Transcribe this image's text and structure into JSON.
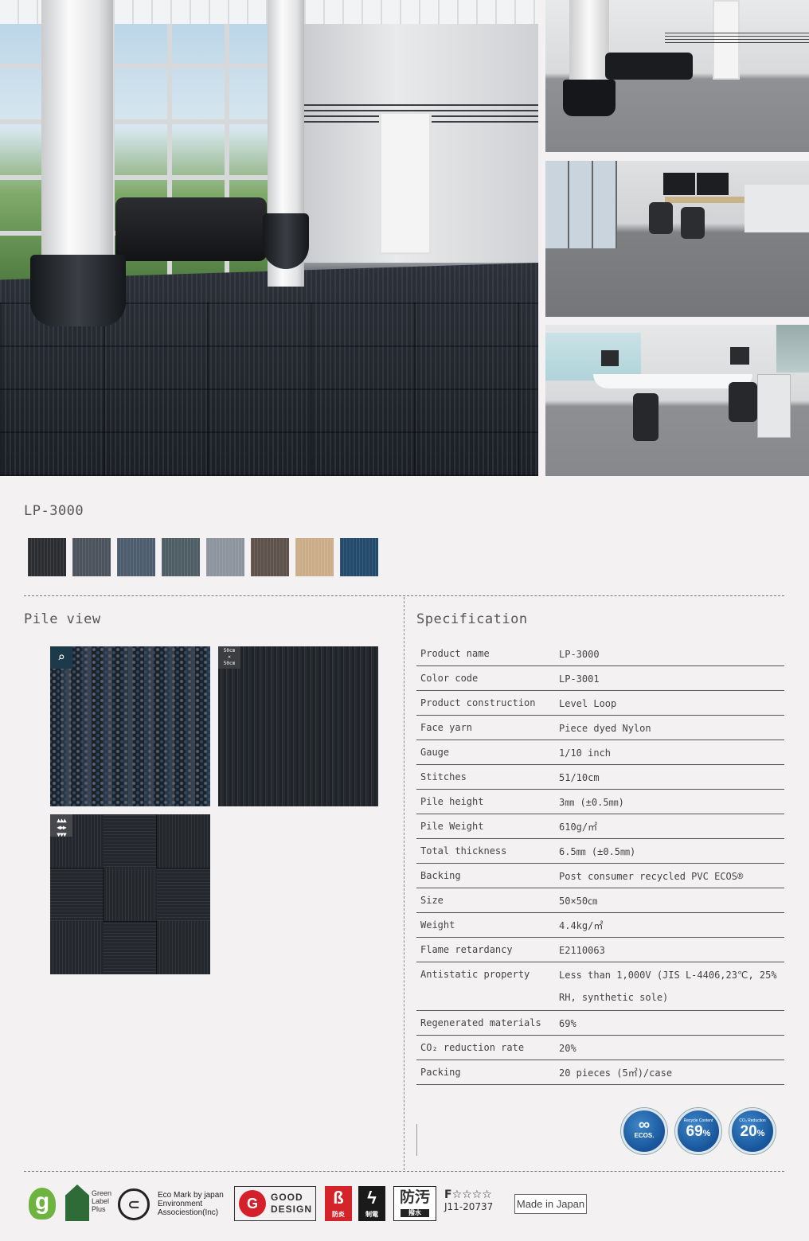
{
  "product": {
    "name": "LP-3000",
    "swatch_colors": [
      "#2b2d30",
      "#4b535c",
      "#4e5d6d",
      "#4f5e65",
      "#8c949d",
      "#5e534b",
      "#cbae88",
      "#224a6b"
    ]
  },
  "pile_view": {
    "title": "Pile view",
    "zoom_icon": "magnifier-icon",
    "size_badge": [
      "50cm",
      "×",
      "50cm"
    ],
    "layout_icon": "arrows-icon"
  },
  "specification": {
    "title": "Specification",
    "rows": [
      {
        "label": "Product name",
        "value": "LP-3000"
      },
      {
        "label": "Color code",
        "value": "LP-3001"
      },
      {
        "label": "Product construction",
        "value": "Level Loop"
      },
      {
        "label": "Face yarn",
        "value": "Piece dyed Nylon"
      },
      {
        "label": "Gauge",
        "value": "1/10 inch"
      },
      {
        "label": "Stitches",
        "value": "51/10cm"
      },
      {
        "label": "Pile height",
        "value": "3㎜ (±0.5㎜)"
      },
      {
        "label": "Pile Weight",
        "value": "610g/㎡"
      },
      {
        "label": "Total thickness",
        "value": "6.5㎜ (±0.5㎜)"
      },
      {
        "label": "Backing",
        "value": "Post consumer recycled PVC ECOS®"
      },
      {
        "label": "Size",
        "value": "50×50㎝"
      },
      {
        "label": "Weight",
        "value": "4.4kg/㎡"
      },
      {
        "label": "Flame retardancy",
        "value": "E2110063"
      },
      {
        "label": "Antistatic property",
        "value": "Less than 1,000V (JIS L-4406,23℃, 25% RH, synthetic sole)"
      },
      {
        "label": "Regenerated materials",
        "value": "69%"
      },
      {
        "label": "CO₂ reduction rate",
        "value": "20%"
      },
      {
        "label": "Packing",
        "value": "20 pieces (5㎡)/case"
      }
    ]
  },
  "eco_badges": {
    "ecos": {
      "text": "ECOS."
    },
    "recycle": {
      "caption": "Recycle Content",
      "value": "69",
      "unit": "%"
    },
    "co2": {
      "caption": "CO₂ Reduction",
      "value": "20",
      "unit": "%"
    }
  },
  "footer": {
    "green_label": "Green\nLabel\nPlus",
    "eco_mark": "Eco Mark by japan\nEnvironment\nAssociestion(Inc)",
    "good_design": "GOOD\nDESIGN",
    "fire_label": "防炎",
    "antistatic_label": "制電",
    "stain_glyph": "防汚",
    "stain_label": "撥水",
    "f_rating": "F☆☆☆☆",
    "f_code": "J11-20737",
    "made_in": "Made in Japan"
  }
}
